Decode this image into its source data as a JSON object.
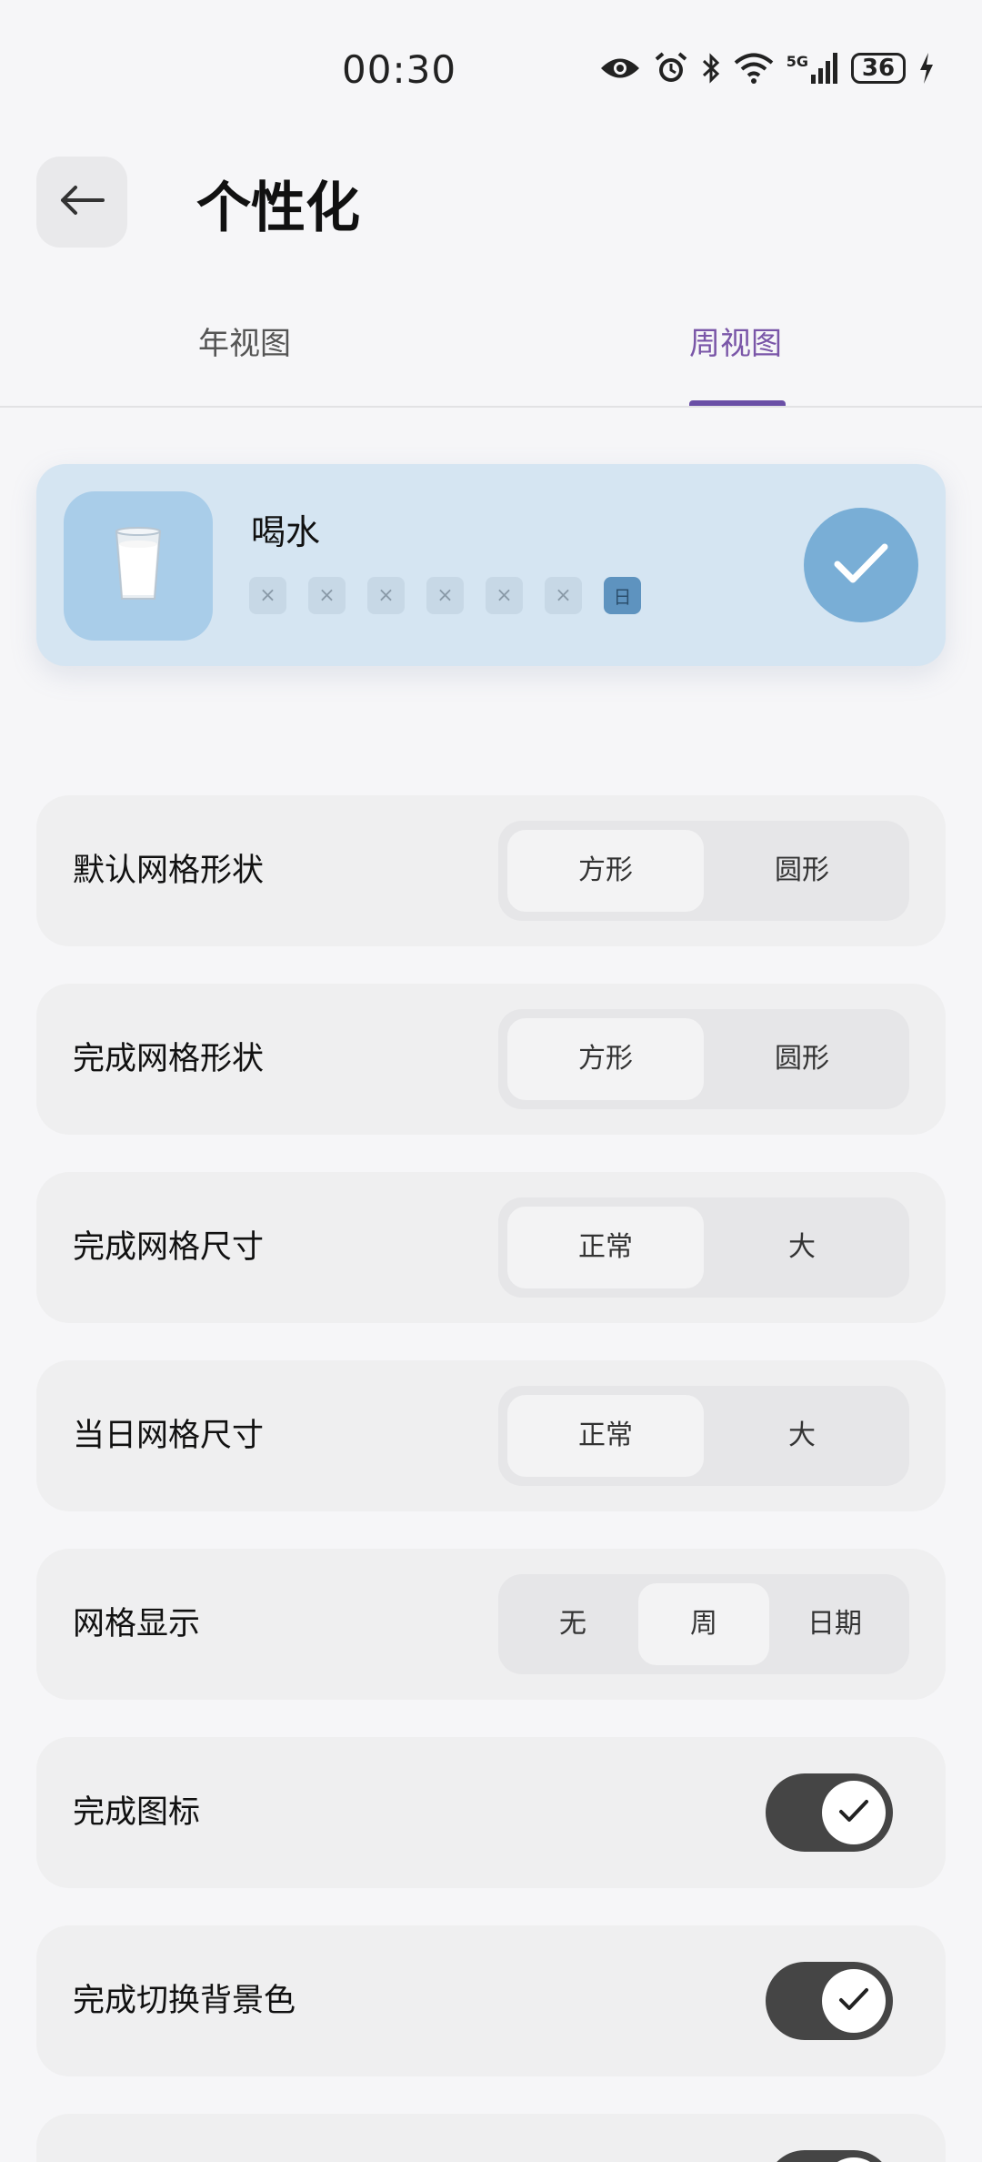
{
  "status_bar": {
    "time": "00:30",
    "battery": "36",
    "icons": [
      "eye-icon",
      "alarm-icon",
      "bluetooth-icon",
      "wifi-icon",
      "5g-signal-icon",
      "battery-icon",
      "charging-icon"
    ],
    "network_label": "5G"
  },
  "header": {
    "title": "个性化",
    "back_icon": "arrow-left-icon"
  },
  "tabs": [
    {
      "label": "年视图",
      "active": false
    },
    {
      "label": "周视图",
      "active": true
    }
  ],
  "accent_color": "#6a4fa6",
  "habit_preview": {
    "name": "喝水",
    "icon": "milk-glass-icon",
    "days": [
      "×",
      "×",
      "×",
      "×",
      "×",
      "×",
      "日"
    ],
    "done": true,
    "color": "#79aed6"
  },
  "settings": [
    {
      "label": "默认网格形状",
      "type": "segmented",
      "options": [
        "方形",
        "圆形"
      ],
      "selected": 0
    },
    {
      "label": "完成网格形状",
      "type": "segmented",
      "options": [
        "方形",
        "圆形"
      ],
      "selected": 0
    },
    {
      "label": "完成网格尺寸",
      "type": "segmented",
      "options": [
        "正常",
        "大"
      ],
      "selected": 0
    },
    {
      "label": "当日网格尺寸",
      "type": "segmented",
      "options": [
        "正常",
        "大"
      ],
      "selected": 0
    },
    {
      "label": "网格显示",
      "type": "segmented",
      "options": [
        "无",
        "周",
        "日期"
      ],
      "selected": 1
    },
    {
      "label": "完成图标",
      "type": "toggle",
      "on": true
    },
    {
      "label": "完成切换背景色",
      "type": "toggle",
      "on": true
    },
    {
      "label": "",
      "type": "toggle",
      "on": true
    }
  ]
}
